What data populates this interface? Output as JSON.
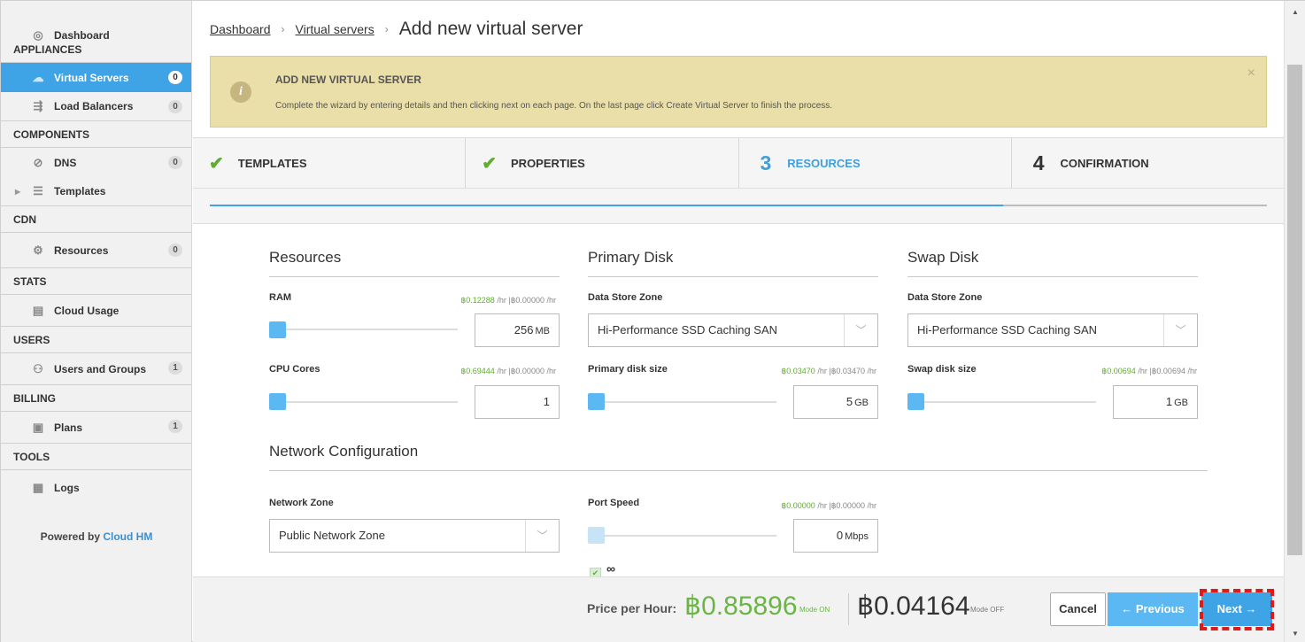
{
  "sidebar": {
    "dashboard": "Dashboard",
    "sections": {
      "appliances": "APPLIANCES",
      "components": "COMPONENTS",
      "cdn": "CDN",
      "stats": "STATS",
      "users": "USERS",
      "billing": "BILLING",
      "tools": "TOOLS"
    },
    "items": {
      "virtual_servers": {
        "label": "Virtual Servers",
        "count": "0"
      },
      "load_balancers": {
        "label": "Load Balancers",
        "count": "0"
      },
      "dns": {
        "label": "DNS",
        "count": "0"
      },
      "templates": {
        "label": "Templates"
      },
      "resources": {
        "label": "Resources",
        "count": "0"
      },
      "cloud_usage": {
        "label": "Cloud Usage"
      },
      "users_groups": {
        "label": "Users and Groups",
        "count": "1"
      },
      "plans": {
        "label": "Plans",
        "count": "1"
      },
      "logs": {
        "label": "Logs"
      }
    },
    "powered_prefix": "Powered by",
    "powered_brand": "Cloud HM"
  },
  "breadcrumb": {
    "home": "Dashboard",
    "parent": "Virtual servers",
    "current": "Add new virtual server",
    "separator": "›"
  },
  "alert": {
    "title": "ADD NEW VIRTUAL SERVER",
    "text": "Complete the wizard by entering details and then clicking next on each page. On the last page click Create Virtual Server to finish the process.",
    "info_glyph": "i",
    "close": "×"
  },
  "steps": [
    {
      "label": "TEMPLATES",
      "mark": "✔",
      "state": "done"
    },
    {
      "label": "PROPERTIES",
      "mark": "✔",
      "state": "done"
    },
    {
      "label": "RESOURCES",
      "mark": "3",
      "state": "current"
    },
    {
      "label": "CONFIRMATION",
      "mark": "4",
      "state": "pending"
    }
  ],
  "wizard_progress": 0.75,
  "resources": {
    "title": "Resources",
    "ram": {
      "label": "RAM",
      "price_on": "฿0.12288",
      "price_off": "|฿0.00000",
      "unit": "/hr",
      "value": "256",
      "value_unit": "MB"
    },
    "cpu": {
      "label": "CPU Cores",
      "price_on": "฿0.69444",
      "price_off": "|฿0.00000",
      "unit": "/hr",
      "value": "1"
    }
  },
  "primary_disk": {
    "title": "Primary Disk",
    "zone_label": "Data Store Zone",
    "zone_value": "Hi-Performance SSD Caching SAN",
    "size_label": "Primary disk size",
    "price_on": "฿0.03470",
    "price_off": "|฿0.03470",
    "unit": "/hr",
    "value": "5",
    "value_unit": "GB"
  },
  "swap_disk": {
    "title": "Swap Disk",
    "zone_label": "Data Store Zone",
    "zone_value": "Hi-Performance SSD Caching SAN",
    "size_label": "Swap disk size",
    "price_on": "฿0.00694",
    "price_off": "|฿0.00694",
    "unit": "/hr",
    "value": "1",
    "value_unit": "GB"
  },
  "network": {
    "title": "Network Configuration",
    "zone_label": "Network Zone",
    "zone_value": "Public Network Zone",
    "port_label": "Port Speed",
    "price_on": "฿0.00000",
    "price_off": "|฿0.00000",
    "unit": "/hr",
    "value": "0",
    "value_unit": "Mbps",
    "unlimited_glyph": "∞",
    "unlimited_checked": true
  },
  "footer": {
    "price_label": "Price per Hour:",
    "price_on": "฿0.85896",
    "mode_on": "Mode ON",
    "price_off": "฿0.04164",
    "mode_off": "Mode OFF",
    "cancel": "Cancel",
    "previous": "← Previous",
    "next": "Next →"
  },
  "colors": {
    "accent": "#3ea4e6",
    "success": "#5fae2f",
    "alert_bg": "#eadfa8",
    "highlight": "#e01919"
  }
}
